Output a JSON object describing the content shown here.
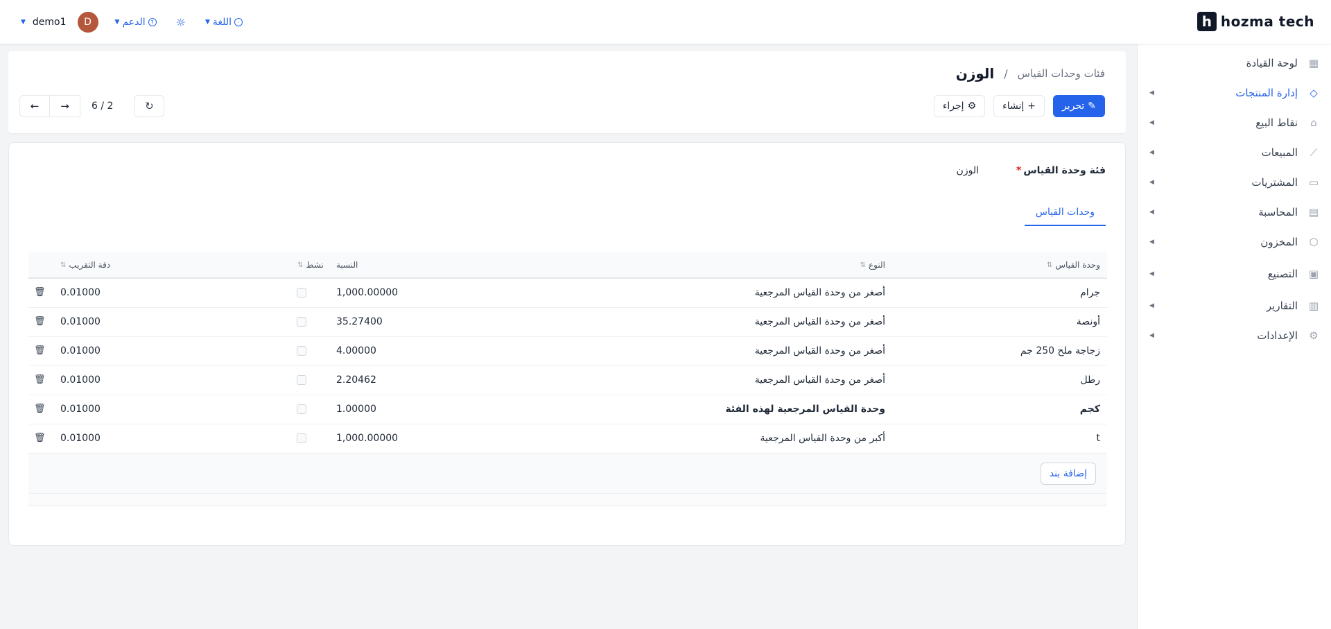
{
  "header": {
    "logo_text": "hozma tech",
    "logo_mark": "h",
    "user_name": "demo1",
    "avatar_initial": "D",
    "support_label": "الدعم",
    "language_label": "اللغة"
  },
  "sidebar": {
    "items": [
      {
        "label": "لوحة القيادة",
        "icon": "dashboard-icon",
        "glyph": "▦",
        "active": false,
        "expandable": false
      },
      {
        "label": "إدارة المنتجات",
        "icon": "tag-icon",
        "glyph": "◇",
        "active": true,
        "expandable": true
      },
      {
        "label": "نقاط البيع",
        "icon": "store-icon",
        "glyph": "⌂",
        "active": false,
        "expandable": true
      },
      {
        "label": "المبيعات",
        "icon": "chart-line-icon",
        "glyph": "⟋",
        "active": false,
        "expandable": true
      },
      {
        "label": "المشتريات",
        "icon": "purchase-icon",
        "glyph": "▭",
        "active": false,
        "expandable": true
      },
      {
        "label": "المحاسبة",
        "icon": "accounting-icon",
        "glyph": "▤",
        "active": false,
        "expandable": true
      },
      {
        "label": "المخزون",
        "icon": "box-icon",
        "glyph": "⬡",
        "active": false,
        "expandable": true
      },
      {
        "label": "التصنيع",
        "icon": "manufacturing-icon",
        "glyph": "▣",
        "active": false,
        "expandable": true
      },
      {
        "label": "التقارير",
        "icon": "report-icon",
        "glyph": "▥",
        "active": false,
        "expandable": true
      },
      {
        "label": "الإعدادات",
        "icon": "gear-icon",
        "glyph": "⚙",
        "active": false,
        "expandable": true
      }
    ]
  },
  "control": {
    "breadcrumb_parent": "فئات وحدات القياس",
    "breadcrumb_sep": "/",
    "breadcrumb_current": "الوزن",
    "edit_label": "تحرير",
    "create_label": "إنشاء",
    "action_label": "إجراء",
    "pager_text": "6 / 2"
  },
  "form": {
    "category_label": "فئة وحدة القياس",
    "category_value": "الوزن",
    "tab_label": "وحدات القياس",
    "columns": {
      "uom": "وحدة القياس",
      "type": "النوع",
      "ratio": "النسبة",
      "active": "نشط",
      "rounding": "دقة التقريب"
    },
    "rows": [
      {
        "uom": "جرام",
        "type": "أصغر من وحدة القياس المرجعية",
        "ratio": "1,000.00000",
        "rounding": "0.01000",
        "reference": false
      },
      {
        "uom": "أونصة",
        "type": "أصغر من وحدة القياس المرجعية",
        "ratio": "35.27400",
        "rounding": "0.01000",
        "reference": false
      },
      {
        "uom": "زجاجة ملح 250 جم",
        "type": "أصغر من وحدة القياس المرجعية",
        "ratio": "4.00000",
        "rounding": "0.01000",
        "reference": false
      },
      {
        "uom": "رطل",
        "type": "أصغر من وحدة القياس المرجعية",
        "ratio": "2.20462",
        "rounding": "0.01000",
        "reference": false
      },
      {
        "uom": "كجم",
        "type": "وحدة القياس المرجعية لهذه الفئة",
        "ratio": "1.00000",
        "rounding": "0.01000",
        "reference": true
      },
      {
        "uom": "t",
        "type": "أكبر من وحدة القياس المرجعية",
        "ratio": "1,000.00000",
        "rounding": "0.01000",
        "reference": false
      }
    ],
    "add_line_label": "إضافة بند"
  }
}
